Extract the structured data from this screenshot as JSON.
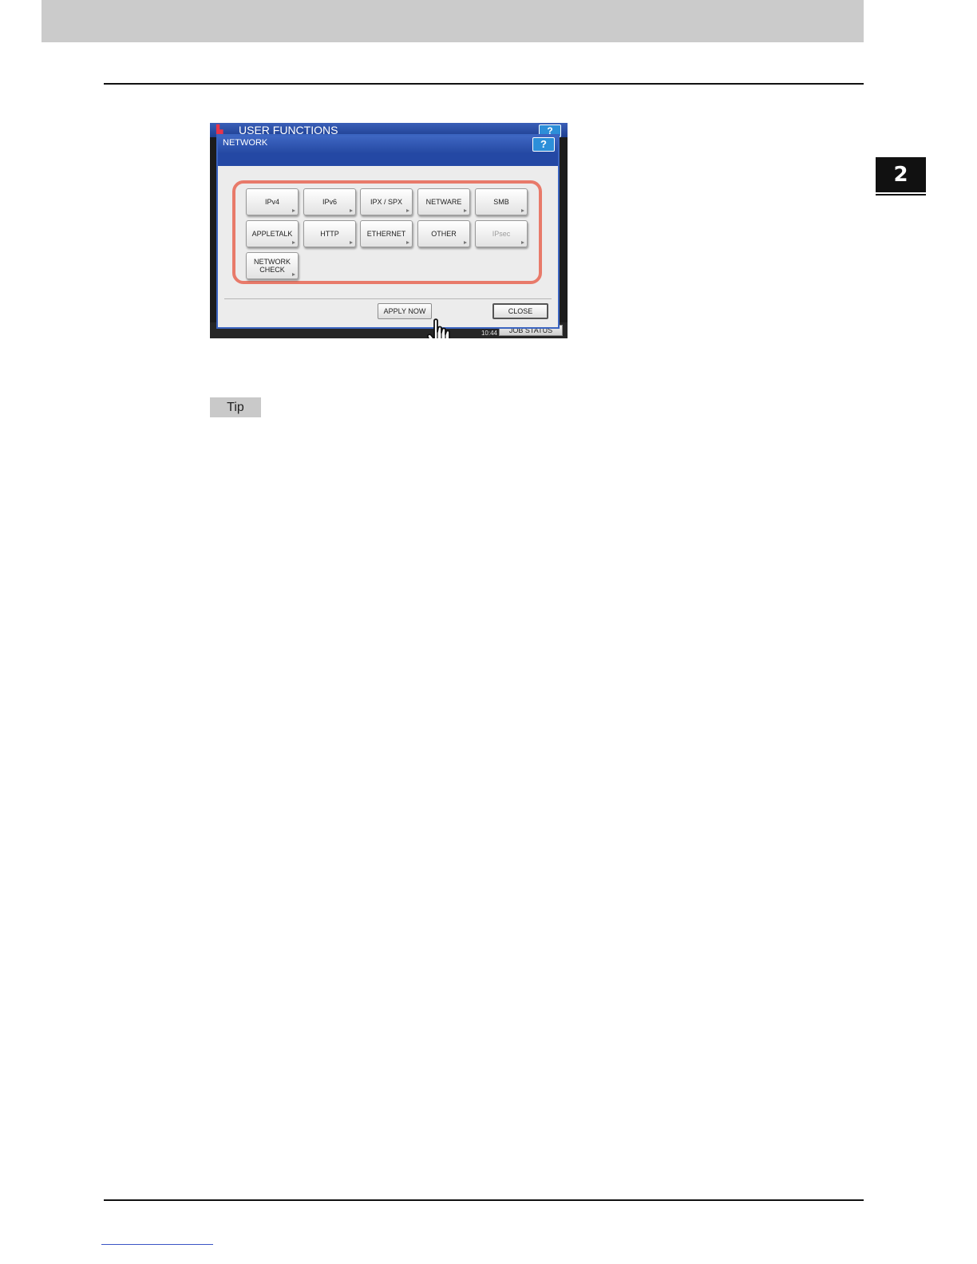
{
  "chapter_number": "2",
  "screenshot": {
    "background_title": "USER FUNCTIONS",
    "background_help": "?",
    "status_clock": "10:44",
    "job_status_label": "JOB STATUS",
    "dialog": {
      "title": "NETWORK",
      "help_label": "?",
      "buttons": [
        {
          "label": "IPv4",
          "enabled": true
        },
        {
          "label": "IPv6",
          "enabled": true
        },
        {
          "label": "IPX / SPX",
          "enabled": true
        },
        {
          "label": "NETWARE",
          "enabled": true
        },
        {
          "label": "SMB",
          "enabled": true
        },
        {
          "label": "APPLETALK",
          "enabled": true
        },
        {
          "label": "HTTP",
          "enabled": true
        },
        {
          "label": "ETHERNET",
          "enabled": true
        },
        {
          "label": "OTHER",
          "enabled": true
        },
        {
          "label": "IPsec",
          "enabled": false
        },
        {
          "label": "NETWORK CHECK",
          "enabled": true
        }
      ],
      "apply_now_label": "APPLY NOW",
      "close_label": "CLOSE"
    }
  },
  "tip_label": "Tip",
  "colors": {
    "header_gray": "#cbcbcb",
    "dialog_blue": "#3b64c0",
    "highlight_red": "#e87a6a",
    "footer_link_blue": "#3a55c6"
  }
}
